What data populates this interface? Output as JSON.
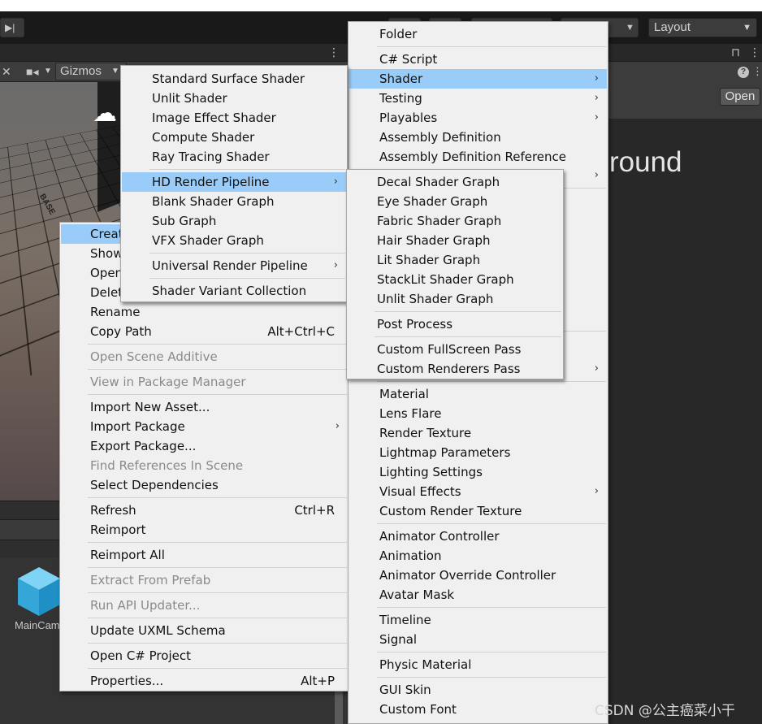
{
  "editor": {
    "layout_label": "Layout",
    "gizmos_label": "Gizmos",
    "open_button": "Open",
    "background_text": "round",
    "main_camera_label": "MainCam",
    "scene_overlay_text": "BASE",
    "watermark": "CSDN @公主癌菜小干"
  },
  "context_menu": {
    "items": [
      {
        "label": "Create",
        "selected": true
      },
      {
        "label": "Show"
      },
      {
        "label": "Open"
      },
      {
        "label": "Delete"
      },
      {
        "label": "Rename"
      },
      {
        "label": "Copy Path",
        "shortcut": "Alt+Ctrl+C"
      },
      {
        "label": "Open Scene Additive",
        "disabled": true
      },
      {
        "label": "View in Package Manager",
        "disabled": true
      },
      {
        "label": "Import New Asset..."
      },
      {
        "label": "Import Package",
        "submenu": true
      },
      {
        "label": "Export Package..."
      },
      {
        "label": "Find References In Scene",
        "disabled": true
      },
      {
        "label": "Select Dependencies"
      },
      {
        "label": "Refresh",
        "shortcut": "Ctrl+R"
      },
      {
        "label": "Reimport"
      },
      {
        "label": "Reimport All"
      },
      {
        "label": "Extract From Prefab",
        "disabled": true
      },
      {
        "label": "Run API Updater...",
        "disabled": true
      },
      {
        "label": "Update UXML Schema"
      },
      {
        "label": "Open C# Project"
      },
      {
        "label": "Properties...",
        "shortcut": "Alt+P"
      }
    ]
  },
  "create_menu": {
    "items": [
      {
        "label": "Folder"
      },
      {
        "label": "C# Script"
      },
      {
        "label": "Shader",
        "submenu": true,
        "selected": true
      },
      {
        "label": "Testing",
        "submenu": true
      },
      {
        "label": "Playables",
        "submenu": true
      },
      {
        "label": "Assembly Definition"
      },
      {
        "label": "Assembly Definition Reference"
      },
      {
        "label": "Material"
      },
      {
        "label": "Lens Flare"
      },
      {
        "label": "Render Texture"
      },
      {
        "label": "Lightmap Parameters"
      },
      {
        "label": "Lighting Settings"
      },
      {
        "label": "Visual Effects",
        "submenu": true
      },
      {
        "label": "Custom Render Texture"
      },
      {
        "label": "Animator Controller"
      },
      {
        "label": "Animation"
      },
      {
        "label": "Animator Override Controller"
      },
      {
        "label": "Avatar Mask"
      },
      {
        "label": "Timeline"
      },
      {
        "label": "Signal"
      },
      {
        "label": "Physic Material"
      },
      {
        "label": "GUI Skin"
      },
      {
        "label": "Custom Font"
      }
    ]
  },
  "shader_menu": {
    "items": [
      {
        "label": "Standard Surface Shader"
      },
      {
        "label": "Unlit Shader"
      },
      {
        "label": "Image Effect Shader"
      },
      {
        "label": "Compute Shader"
      },
      {
        "label": "Ray Tracing Shader"
      },
      {
        "label": "HD Render Pipeline",
        "submenu": true,
        "selected": true
      },
      {
        "label": "Blank Shader Graph"
      },
      {
        "label": "Sub Graph"
      },
      {
        "label": "VFX Shader Graph"
      },
      {
        "label": "Universal Render Pipeline",
        "submenu": true
      },
      {
        "label": "Shader Variant Collection"
      }
    ]
  },
  "hdrp_menu": {
    "items": [
      {
        "label": "Decal Shader Graph"
      },
      {
        "label": "Eye Shader Graph"
      },
      {
        "label": "Fabric Shader Graph"
      },
      {
        "label": "Hair Shader Graph"
      },
      {
        "label": "Lit Shader Graph"
      },
      {
        "label": "StackLit Shader Graph"
      },
      {
        "label": "Unlit Shader Graph"
      },
      {
        "label": "Post Process"
      },
      {
        "label": "Custom FullScreen Pass"
      },
      {
        "label": "Custom Renderers Pass"
      }
    ]
  },
  "submenu_arrow": "›",
  "colors": {
    "selection": "#99ccf9",
    "menu_background": "#f0f0f0",
    "disabled_text": "#8a8a8a",
    "editor_dark": "#282828"
  }
}
